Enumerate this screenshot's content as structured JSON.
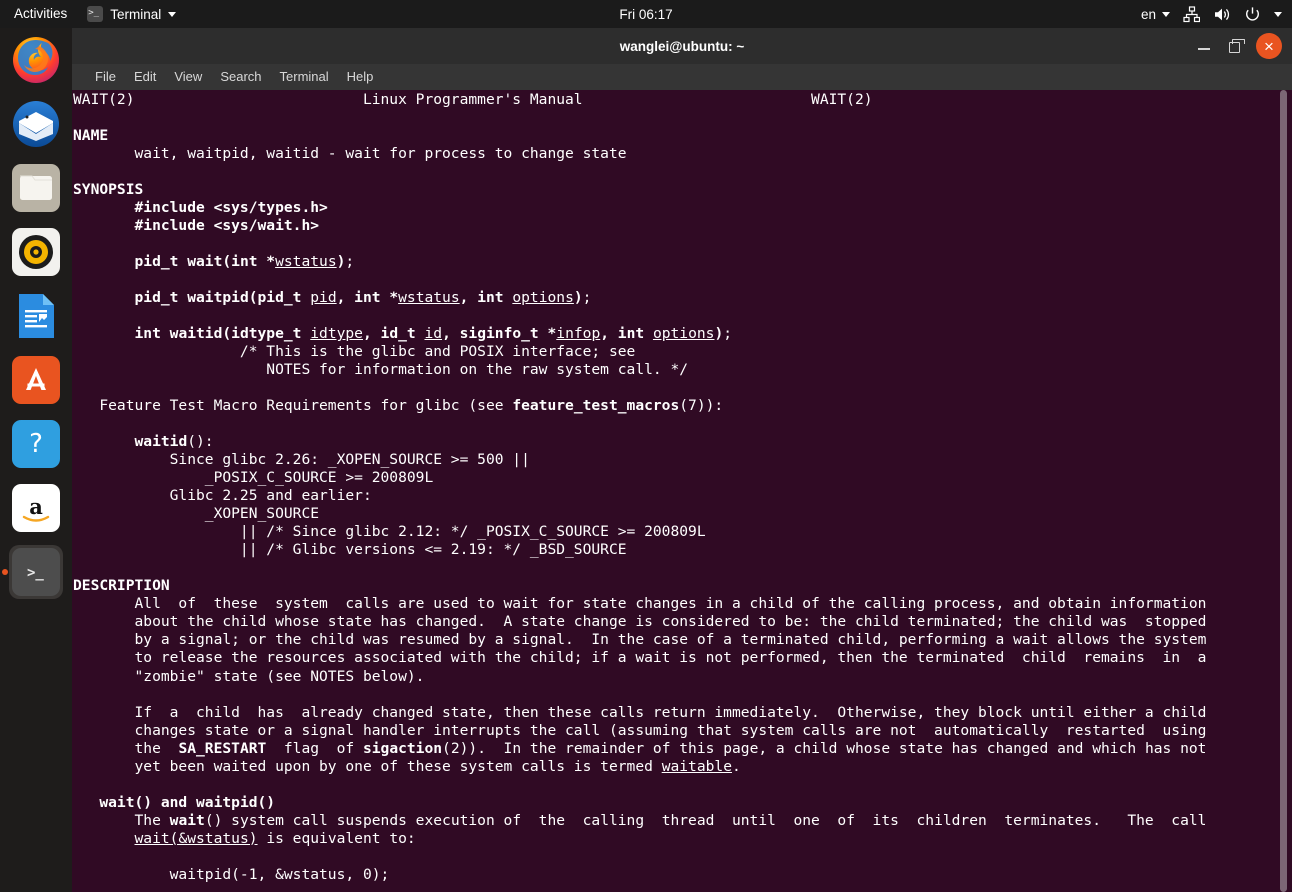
{
  "topbar": {
    "activities": "Activities",
    "app_name": "Terminal",
    "app_icon": "terminal-icon",
    "clock": "Fri 06:17",
    "language": "en",
    "tray_icons": [
      "network-icon",
      "volume-icon",
      "power-icon",
      "chevron-down-icon"
    ]
  },
  "dock": {
    "items": [
      {
        "name": "firefox",
        "label": "Firefox Web Browser",
        "active": false
      },
      {
        "name": "thunderbird",
        "label": "Thunderbird Mail",
        "active": false
      },
      {
        "name": "files",
        "label": "Files",
        "active": false
      },
      {
        "name": "rhythmbox",
        "label": "Rhythmbox",
        "active": false
      },
      {
        "name": "libreoffice-writer",
        "label": "LibreOffice Writer",
        "active": false
      },
      {
        "name": "ubuntu-software",
        "label": "Ubuntu Software",
        "active": false
      },
      {
        "name": "help",
        "label": "Help",
        "active": false
      },
      {
        "name": "amazon",
        "label": "Amazon",
        "active": false
      },
      {
        "name": "terminal",
        "label": "Terminal",
        "active": true
      }
    ]
  },
  "window": {
    "title": "wanglei@ubuntu: ~",
    "buttons": {
      "minimize": "minimize",
      "maximize": "maximize",
      "close": "close"
    },
    "menu": [
      "File",
      "Edit",
      "View",
      "Search",
      "Terminal",
      "Help"
    ]
  },
  "terminal": {
    "background_color": "#300a24",
    "foreground_color": "#ffffff",
    "man_page": "WAIT(2)",
    "man_header_center": "Linux Programmer's Manual",
    "content_lines": [
      "WAIT(2)                          Linux Programmer's Manual                          WAIT(2)",
      "",
      "NAME",
      "       wait, waitpid, waitid - wait for process to change state",
      "",
      "SYNOPSIS",
      "       #include <sys/types.h>",
      "       #include <sys/wait.h>",
      "",
      "       pid_t wait(int *wstatus);",
      "",
      "       pid_t waitpid(pid_t pid, int *wstatus, int options);",
      "",
      "       int waitid(idtype_t idtype, id_t id, siginfo_t *infop, int options);",
      "                   /* This is the glibc and POSIX interface; see",
      "                      NOTES for information on the raw system call. */",
      "",
      "   Feature Test Macro Requirements for glibc (see feature_test_macros(7)):",
      "",
      "       waitid():",
      "           Since glibc 2.26: _XOPEN_SOURCE >= 500 ||",
      "               _POSIX_C_SOURCE >= 200809L",
      "           Glibc 2.25 and earlier:",
      "               _XOPEN_SOURCE",
      "                   || /* Since glibc 2.12: */ _POSIX_C_SOURCE >= 200809L",
      "                   || /* Glibc versions <= 2.19: */ _BSD_SOURCE",
      "",
      "DESCRIPTION",
      "       All  of  these  system  calls are used to wait for state changes in a child of the calling process, and obtain information",
      "       about the child whose state has changed.  A state change is considered to be: the child terminated; the child was  stopped",
      "       by a signal; or the child was resumed by a signal.  In the case of a terminated child, performing a wait allows the system",
      "       to release the resources associated with the child; if a wait is not performed, then the terminated  child  remains  in  a",
      "       \"zombie\" state (see NOTES below).",
      "",
      "       If  a  child  has  already changed state, then these calls return immediately.  Otherwise, they block until either a child",
      "       changes state or a signal handler interrupts the call (assuming that system calls are not  automatically  restarted  using",
      "       the  SA_RESTART  flag  of sigaction(2)).  In the remainder of this page, a child whose state has changed and which has not",
      "       yet been waited upon by one of these system calls is termed waitable.",
      "",
      "   wait() and waitpid()",
      "       The wait() system call suspends execution of  the  calling  thread  until  one  of  its  children  terminates.   The  call",
      "       wait(&wstatus) is equivalent to:",
      "",
      "           waitpid(-1, &wstatus, 0);"
    ]
  },
  "scrollbar": {
    "name": "vertical-scrollbar",
    "thumb_position": "top"
  }
}
